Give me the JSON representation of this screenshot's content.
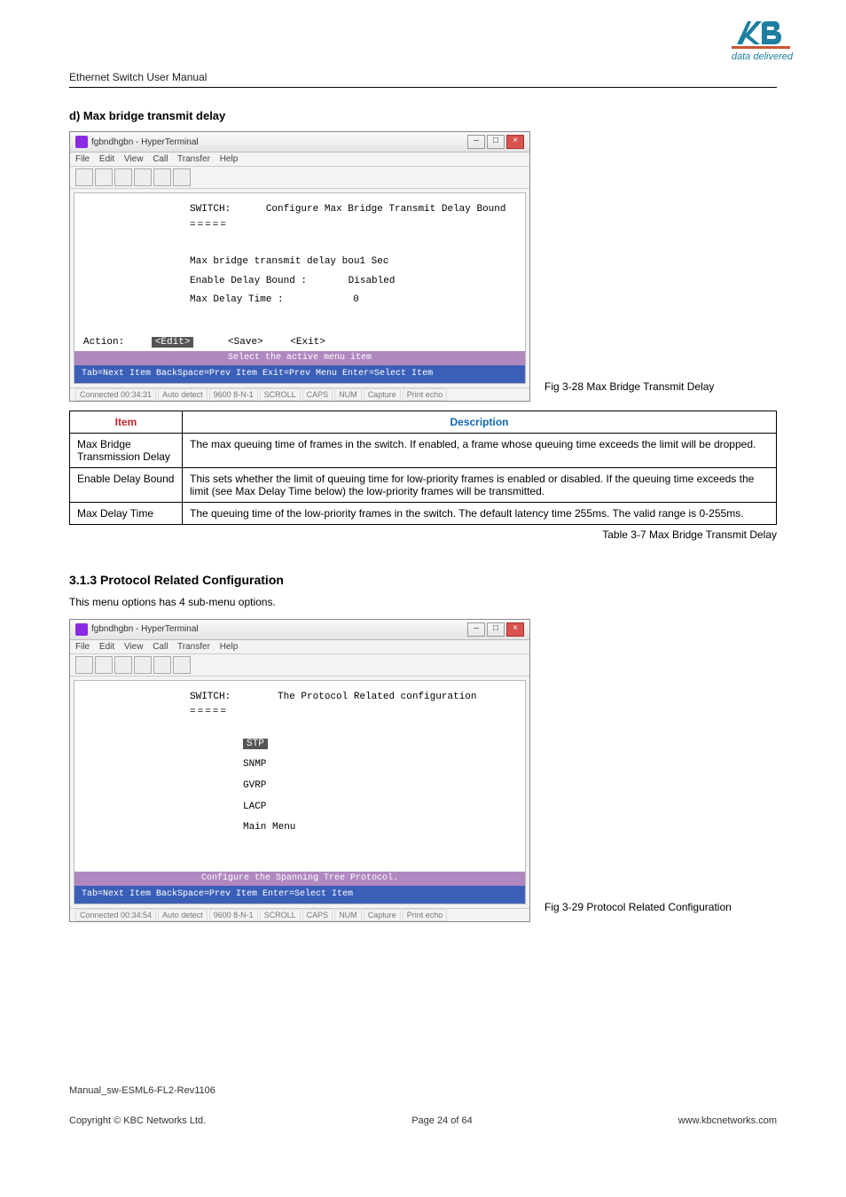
{
  "logo_tagline": "data delivered",
  "header_text": "Ethernet Switch User Manual",
  "section_d_title": "d)    Max bridge transmit delay",
  "term1": {
    "title": "fgbndhgbn - HyperTerminal",
    "menubar": [
      "File",
      "Edit",
      "View",
      "Call",
      "Transfer",
      "Help"
    ],
    "switch_label": "SWITCH:",
    "heading": "Configure Max Bridge Transmit Delay Bound",
    "rows": [
      {
        "label": "Max bridge transmit delay bou1 Sec",
        "value": ""
      },
      {
        "label": "Enable Delay Bound :",
        "value": "Disabled"
      },
      {
        "label": "Max Delay Time :",
        "value": "0"
      }
    ],
    "action_label": "Action:",
    "edit": "<Edit>",
    "save": "<Save>",
    "exit": "<Exit>",
    "select_bar": "Select the active menu item",
    "bottom_help": "Tab=Next Item    BackSpace=Prev Item    Exit=Prev Menu   Enter=Select Item",
    "status": [
      "Connected 00:34:31",
      "Auto detect",
      "9600 8-N-1",
      "SCROLL",
      "CAPS",
      "NUM",
      "Capture",
      "Print echo"
    ]
  },
  "fig1_caption": "Fig 3-28 Max Bridge Transmit Delay",
  "table_headers": {
    "item": "Item",
    "description": "Description"
  },
  "table_rows": [
    {
      "item": "Max Bridge Transmission Delay",
      "desc": "The max queuing time of frames in the switch. If enabled, a frame whose queuing time exceeds the limit will be dropped."
    },
    {
      "item": "Enable Delay Bound",
      "desc": "This sets whether the limit of queuing time for low-priority frames is enabled or disabled. If the queuing time exceeds the limit (see Max Delay Time below) the low-priority frames will be transmitted."
    },
    {
      "item": "Max Delay Time",
      "desc": "The queuing time of the low-priority frames in the switch. The default latency time 255ms. The valid range is 0-255ms."
    }
  ],
  "table_caption": "Table 3-7 Max Bridge Transmit Delay",
  "section_313_title": "3.1.3 Protocol Related Configuration",
  "section_313_text": "This menu options has 4 sub-menu options.",
  "term2": {
    "title": "fgbndhgbn - HyperTerminal",
    "menubar": [
      "File",
      "Edit",
      "View",
      "Call",
      "Transfer",
      "Help"
    ],
    "switch_label": "SWITCH:",
    "heading": "The Protocol Related configuration",
    "menu_items": [
      "STP",
      "SNMP",
      "GVRP",
      "LACP",
      "Main Menu"
    ],
    "selected_index": 0,
    "bottom_bar1": "Configure the Spanning Tree Protocol.",
    "bottom_help": "Tab=Next Item        BackSpace=Prev Item             Enter=Select Item",
    "status": [
      "Connected 00:34:54",
      "Auto detect",
      "9600 8-N-1",
      "SCROLL",
      "CAPS",
      "NUM",
      "Capture",
      "Print echo"
    ]
  },
  "fig2_caption": "Fig 3-29 Protocol Related Configuration",
  "footer_manual": "Manual_sw-ESML6-FL2-Rev1106",
  "footer_left": "Copyright © KBC Networks Ltd.",
  "footer_center": "Page 24 of 64",
  "footer_right": "www.kbcnetworks.com"
}
